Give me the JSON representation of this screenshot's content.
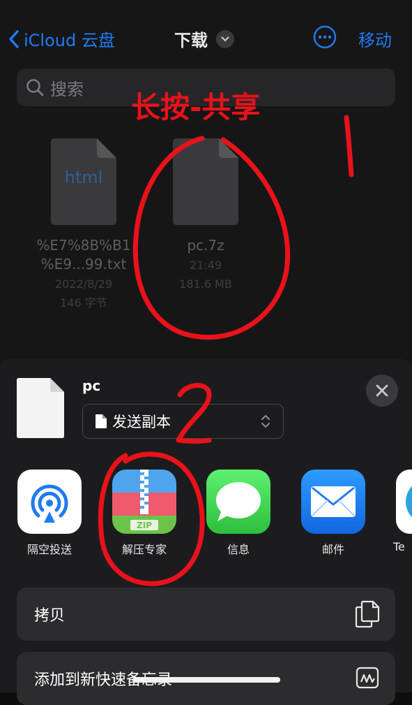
{
  "nav": {
    "back_label": "iCloud 云盘",
    "title": "下载",
    "move_label": "移动"
  },
  "search": {
    "placeholder": "搜索"
  },
  "files": [
    {
      "name_line1": "%E7%8B%B1",
      "name_line2": "%E9...99.txt",
      "date": "2022/8/29",
      "size": "146 字节",
      "icon_text": "html"
    },
    {
      "name_line1": "pc.7z",
      "time": "21:49",
      "size": "181.6 MB"
    }
  ],
  "annotations": {
    "title": "长按-共享",
    "step1": "1",
    "step2": "2",
    "color": "#e8121b"
  },
  "share_sheet": {
    "file_name": "pc",
    "send_option": "发送副本",
    "apps": [
      {
        "label": "隔空投送",
        "icon": "airdrop-icon"
      },
      {
        "label": "解压专家",
        "icon": "zip-icon"
      },
      {
        "label": "信息",
        "icon": "messages-icon"
      },
      {
        "label": "邮件",
        "icon": "mail-icon"
      },
      {
        "label": "Te",
        "icon": "telegram-icon"
      }
    ],
    "actions": [
      {
        "label": "拷贝",
        "icon": "copy-icon"
      },
      {
        "label": "添加到新快速备忘录",
        "icon": "quick-note-icon"
      }
    ]
  },
  "colors": {
    "accent": "#1f7bf2",
    "background": "#161617",
    "sheet": "#1c1c1e"
  }
}
